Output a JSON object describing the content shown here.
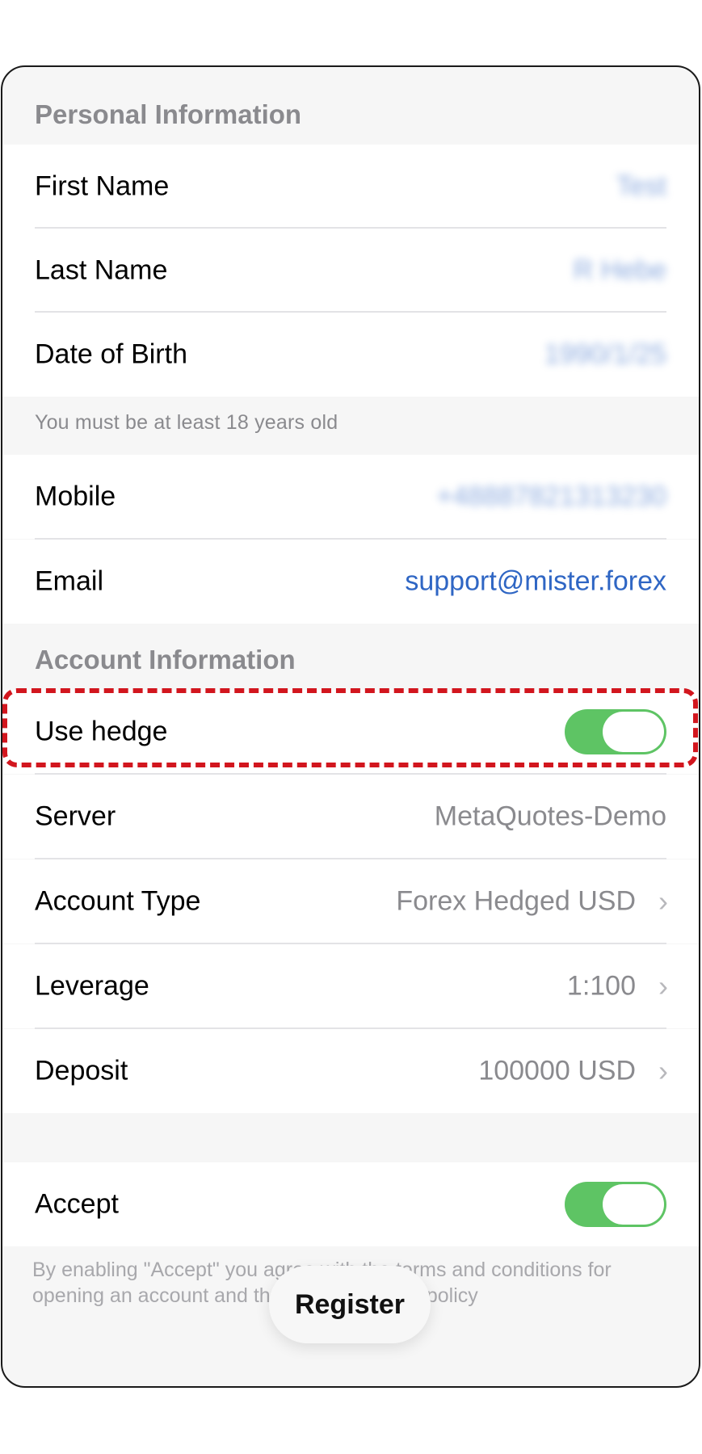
{
  "personal": {
    "title": "Personal Information",
    "first_name": {
      "label": "First Name",
      "value": "Test"
    },
    "last_name": {
      "label": "Last Name",
      "value": "R Hebe"
    },
    "dob": {
      "label": "Date of Birth",
      "value": "1990/1/25"
    },
    "age_note": "You must be at least 18 years old",
    "mobile": {
      "label": "Mobile",
      "value": "+48887821313230"
    },
    "email": {
      "label": "Email",
      "value": "support@mister.forex"
    }
  },
  "account": {
    "title": "Account Information",
    "use_hedge": {
      "label": "Use hedge",
      "enabled": true
    },
    "server": {
      "label": "Server",
      "value": "MetaQuotes-Demo"
    },
    "account_type": {
      "label": "Account Type",
      "value": "Forex Hedged USD"
    },
    "leverage": {
      "label": "Leverage",
      "value": "1:100"
    },
    "deposit": {
      "label": "Deposit",
      "value": "100000 USD"
    }
  },
  "accept": {
    "label": "Accept",
    "enabled": true,
    "legal_text": "By enabling \"Accept\" you agree with the terms and conditions for opening an account and the data protection policy"
  },
  "register_button": "Register",
  "colors": {
    "toggle_on": "#5ec464",
    "link": "#2f66c4",
    "highlight": "#d2161e"
  },
  "icons": {
    "chevron": "chevron-right-icon"
  }
}
